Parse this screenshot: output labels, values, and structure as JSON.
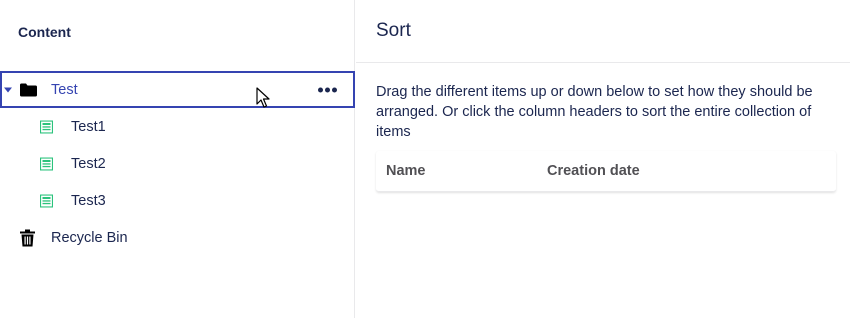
{
  "sidebar": {
    "header": "Content",
    "tree": {
      "root": {
        "label": "Test"
      },
      "children": [
        {
          "label": "Test1"
        },
        {
          "label": "Test2"
        },
        {
          "label": "Test3"
        }
      ],
      "recycle_bin": {
        "label": "Recycle Bin"
      }
    }
  },
  "main": {
    "title": "Sort",
    "instructions": "Drag the different items up or down below to set how they should be arranged. Or click the column headers to sort the entire collection of items",
    "table": {
      "columns": [
        "Name",
        "Creation date"
      ]
    }
  },
  "colors": {
    "accent": "#3544b1",
    "text": "#1b264f",
    "doc_icon": "#2bc37c"
  },
  "icons": {
    "root": "folder-icon",
    "children": "document-icon",
    "recycle_bin": "trash-icon",
    "actions": "more-horizontal-icon",
    "caret": "caret-down-icon"
  }
}
